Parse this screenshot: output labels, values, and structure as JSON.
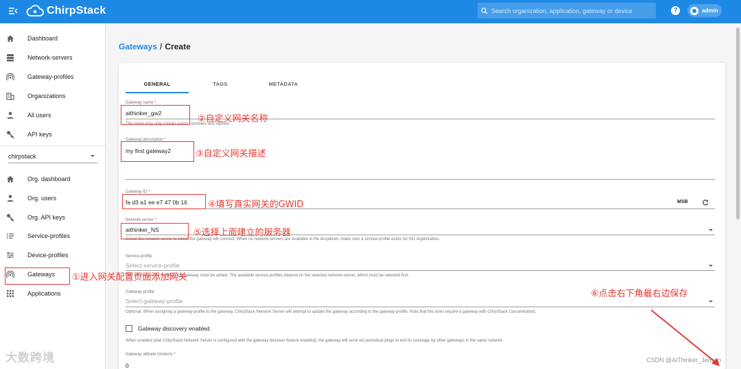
{
  "app": {
    "name": "ChirpStack"
  },
  "header": {
    "search_placeholder": "Search organization, application, gateway or device",
    "user": "admin",
    "accent_color": "#1e88e5"
  },
  "sidebar": {
    "global_items": [
      {
        "label": "Dashboard",
        "icon": "home-icon"
      },
      {
        "label": "Network-servers",
        "icon": "server-icon"
      },
      {
        "label": "Gateway-profiles",
        "icon": "rss-icon"
      },
      {
        "label": "Organizations",
        "icon": "building-icon"
      },
      {
        "label": "All users",
        "icon": "person-icon"
      },
      {
        "label": "API keys",
        "icon": "key-icon"
      }
    ],
    "org_selected": "chirpstack",
    "org_items": [
      {
        "label": "Org. dashboard",
        "icon": "home-icon"
      },
      {
        "label": "Org. users",
        "icon": "person-icon"
      },
      {
        "label": "Org. API keys",
        "icon": "key-icon"
      },
      {
        "label": "Service-profiles",
        "icon": "list-icon"
      },
      {
        "label": "Device-profiles",
        "icon": "tune-icon"
      },
      {
        "label": "Gateways",
        "icon": "rss-icon"
      },
      {
        "label": "Applications",
        "icon": "apps-icon"
      }
    ]
  },
  "breadcrumb": {
    "parent": "Gateways",
    "separator": "/",
    "current": "Create"
  },
  "tabs": [
    "GENERAL",
    "TAGS",
    "METADATA"
  ],
  "form": {
    "name": {
      "label": "Gateway name *",
      "value": "aithinker_gw2",
      "helper": "The name may only contain words, numbers and dashes."
    },
    "description": {
      "label": "Gateway description *",
      "value": "my first gateway2"
    },
    "gateway_id": {
      "label": "Gateway ID *",
      "value": "fa d3 a1 ee e7 47 0b 16",
      "byte_order": "MSB"
    },
    "network_server": {
      "label": "Network-server *",
      "value": "aithinker_NS",
      "helper": "Select the network-server to which the gateway will connect. When no network-servers are available in the dropdown, make sure a service-profile exists for this organization."
    },
    "service_profile": {
      "label": "Service-profile",
      "placeholder": "Select service-profile",
      "helper": "The service-profile to which the gateway must be added. The available service-profiles depend on the selected network-server, which must be selected first."
    },
    "gateway_profile": {
      "label": "Gateway-profile",
      "placeholder": "Select gateway-profile",
      "helper": "Optional. When assigning a gateway-profile to the gateway, ChirpStack Network Server will attempt to update the gateway according to the gateway-profile. Note that this does require a gateway with ChirpStack Concentratord."
    },
    "discovery": {
      "label": "Gateway discovery enabled",
      "helper": "When enabled (and ChirpStack Network Server is configured with the gateway discover feature enabled), the gateway will send out periodical pings to test its coverage by other gateways in the same network."
    },
    "altitude": {
      "label": "Gateway altitude (meters) *",
      "value": "0"
    }
  },
  "annotations": {
    "a1": "①进入网关配置页面添加网关",
    "a2": "②自定义网关名称",
    "a3": "③自定义网关描述",
    "a4": "④填写真实网关的GWID",
    "a5": "⑤选择上面建立的服务器",
    "a6": "⑥点击右下角最右边保存",
    "color": "#e53935"
  },
  "watermarks": {
    "left": "大数跨境",
    "right": "CSDN @AiThinker_Jenson"
  }
}
